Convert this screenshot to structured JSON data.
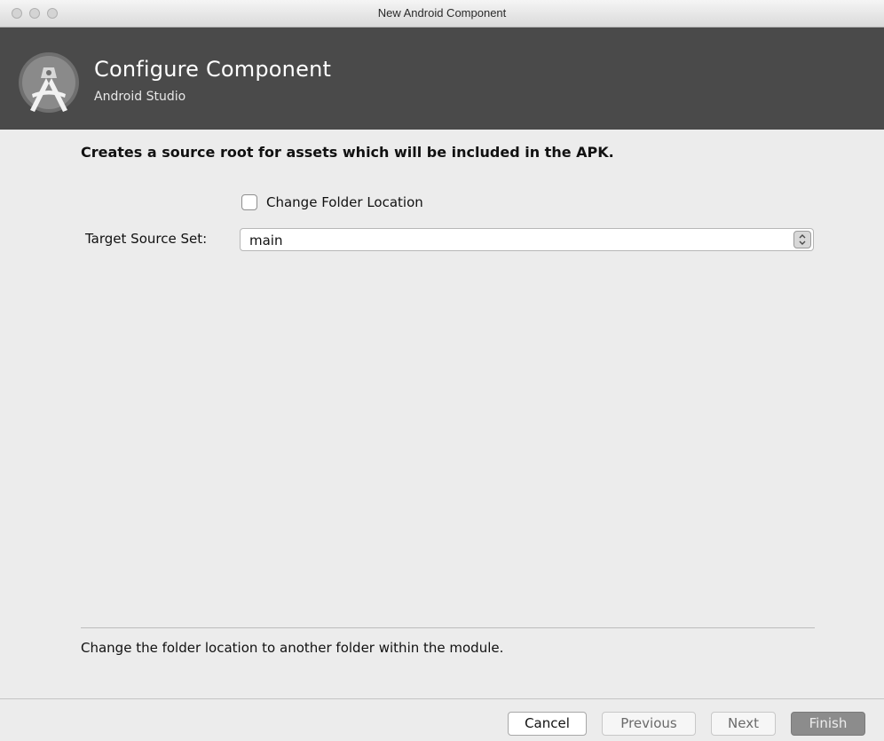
{
  "window": {
    "title": "New Android Component"
  },
  "header": {
    "title": "Configure Component",
    "subtitle": "Android Studio",
    "logo_icon": "android-studio-logo-icon"
  },
  "main": {
    "description": "Creates a source root for assets which will be included in the APK.",
    "change_folder_location": {
      "label": "Change Folder Location",
      "checked": false
    },
    "target_source_set": {
      "label": "Target Source Set:",
      "value": "main"
    },
    "help_text": "Change the folder location to another folder within the module."
  },
  "footer": {
    "cancel_label": "Cancel",
    "previous_label": "Previous",
    "next_label": "Next",
    "finish_label": "Finish"
  },
  "colors": {
    "banner_background": "#4a4a4a",
    "window_background": "#ececec"
  }
}
